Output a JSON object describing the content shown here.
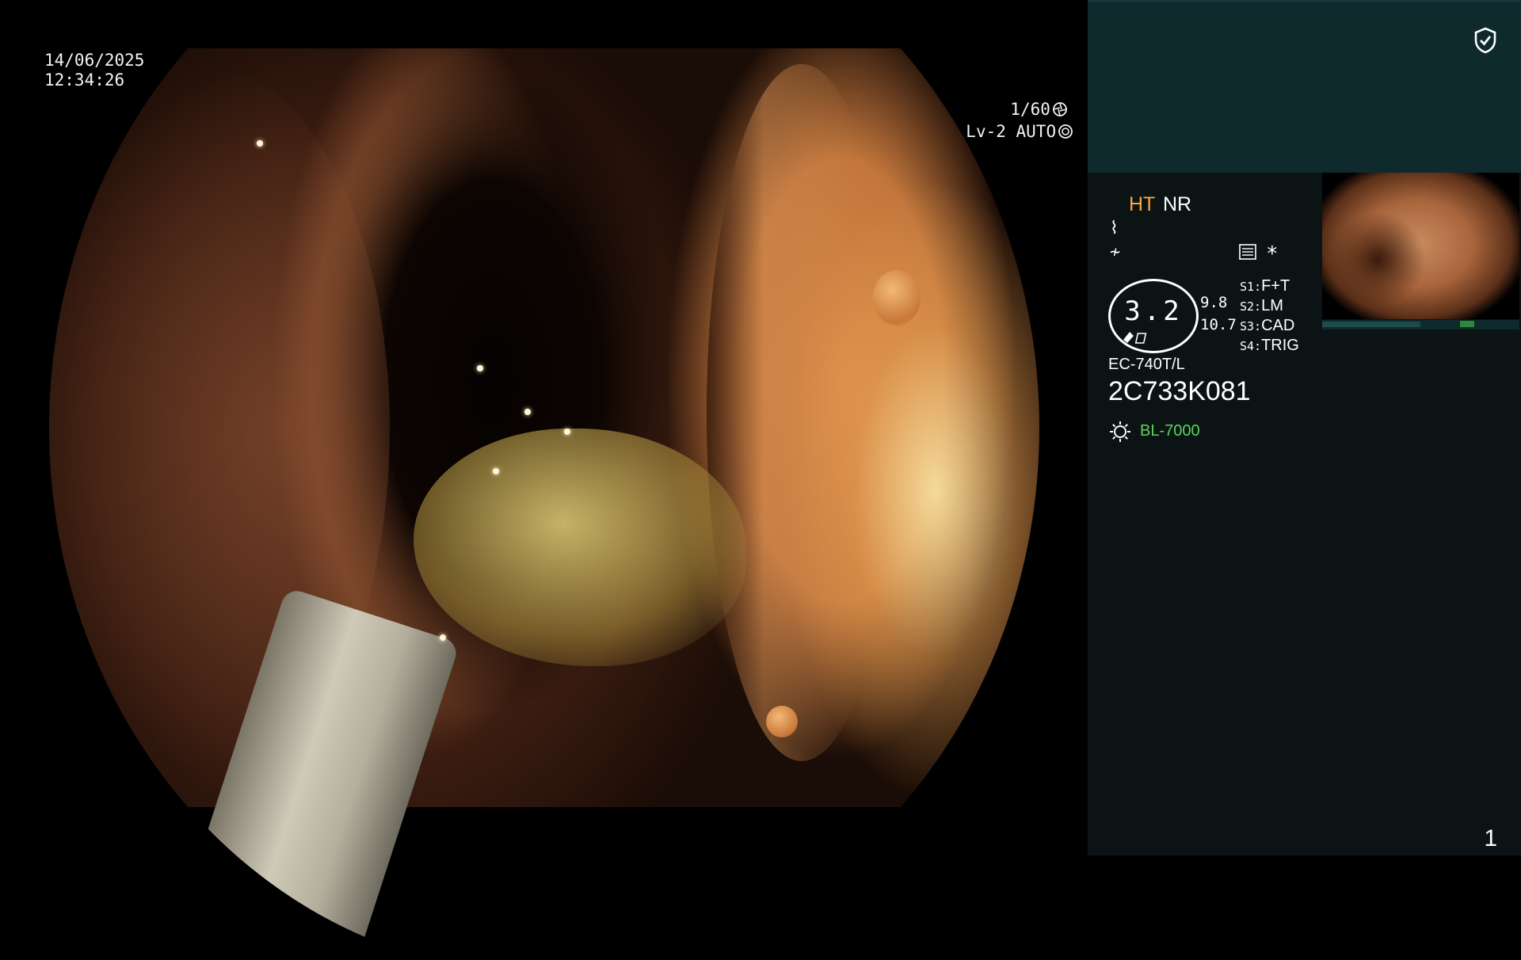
{
  "overlay": {
    "date": "14/06/2025",
    "time": "12:34:26",
    "shutter": "1/60",
    "shutter_icon": "shutter-icon",
    "level": "Lv-2 AUTO",
    "level_icon": "aperture-icon"
  },
  "panel": {
    "shield_icon": "shield-check-icon",
    "mode_ht": "HT",
    "mode_nr": "NR",
    "symbol_1": "⌇",
    "symbol_2": "≁",
    "settings_icon": "settings-icon",
    "asterisk": "*",
    "iris_value": "3.2",
    "metric_1": "9.8",
    "metric_2": "10.7",
    "switches": [
      {
        "label": "S1:",
        "value": "F+T"
      },
      {
        "label": "S2:",
        "value": "LM"
      },
      {
        "label": "S3:",
        "value": "CAD"
      },
      {
        "label": "S4:",
        "value": "TRIG"
      }
    ],
    "scope_model": "EC-740T/L",
    "serial": "2C733K081",
    "light_icon": "light-source-icon",
    "light_source": "BL-7000",
    "page_number": "1"
  },
  "colors": {
    "panel_bg": "#0b1314",
    "panel_top": "#0e2a2c",
    "ht_color": "#f5a742",
    "light_color": "#5ad45a"
  }
}
